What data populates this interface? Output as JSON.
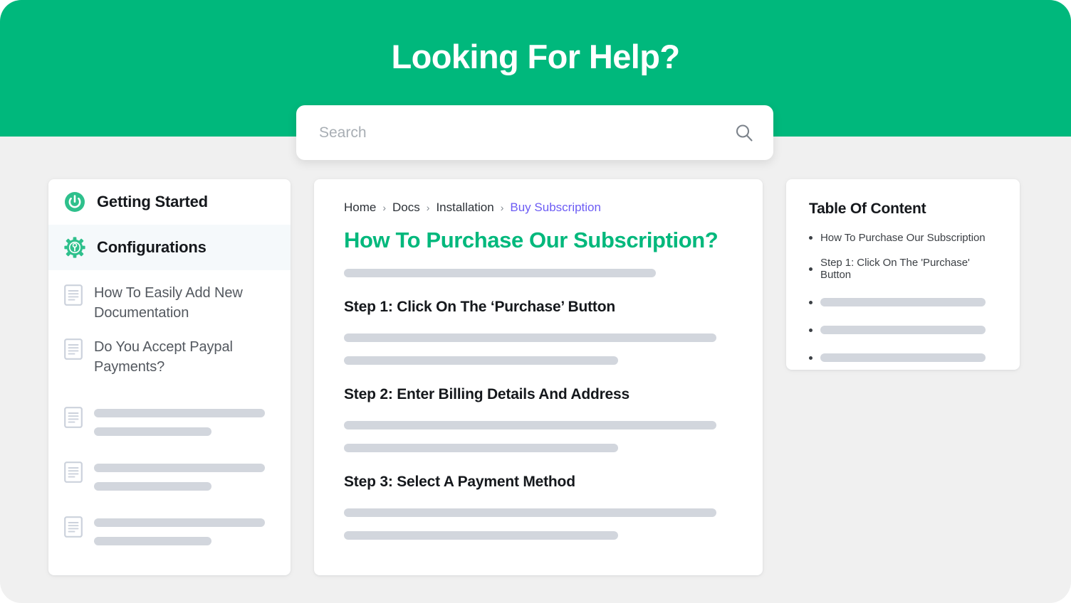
{
  "hero": {
    "title": "Looking For Help?",
    "background_color": "#00b87c"
  },
  "search": {
    "placeholder": "Search",
    "value": "",
    "icon": "search-icon"
  },
  "sidebar": {
    "primary_items": [
      {
        "label": "Getting Started",
        "icon": "power-icon",
        "active": false
      },
      {
        "label": "Configurations",
        "icon": "gear-icon",
        "active": true
      }
    ],
    "doc_items": [
      {
        "label": "How To Easily Add New Documentation",
        "icon": "document-icon"
      },
      {
        "label": "Do You Accept Paypal Payments?",
        "icon": "document-icon"
      }
    ],
    "placeholder_items": [
      {
        "icon": "document-icon",
        "bars": [
          240,
          165
        ]
      },
      {
        "icon": "document-icon",
        "bars": [
          240,
          165
        ]
      },
      {
        "icon": "document-icon",
        "bars": [
          240,
          165
        ]
      }
    ]
  },
  "main": {
    "breadcrumb": [
      {
        "label": "Home",
        "current": false
      },
      {
        "label": "Docs",
        "current": false
      },
      {
        "label": "Installation",
        "current": false
      },
      {
        "label": "Buy Subscription",
        "current": true
      }
    ],
    "breadcrumb_separator": "›",
    "title": "How To Purchase Our Subscription?",
    "title_color": "#00b87c",
    "intro_bars": [
      438
    ],
    "sections": [
      {
        "heading": "Step 1: Click On The ‘Purchase’ Button",
        "bars": [
          523,
          385
        ]
      },
      {
        "heading": "Step 2: Enter Billing Details And Address",
        "bars": [
          523,
          385
        ]
      },
      {
        "heading": "Step 3: Select A Payment Method",
        "bars": [
          523,
          385
        ]
      }
    ]
  },
  "toc": {
    "title": "Table Of Content",
    "items": [
      {
        "label": "How To Purchase Our Subscription"
      },
      {
        "label": "Step 1: Click On The 'Purchase' Button"
      }
    ],
    "placeholder_items": [
      232,
      232,
      232
    ]
  },
  "colors": {
    "accent_green": "#00b87c",
    "link_purple": "#6c5cf4",
    "skeleton_gray": "#d2d6dd",
    "page_background": "#f0f0f0",
    "active_row": "#f5f9fb"
  }
}
